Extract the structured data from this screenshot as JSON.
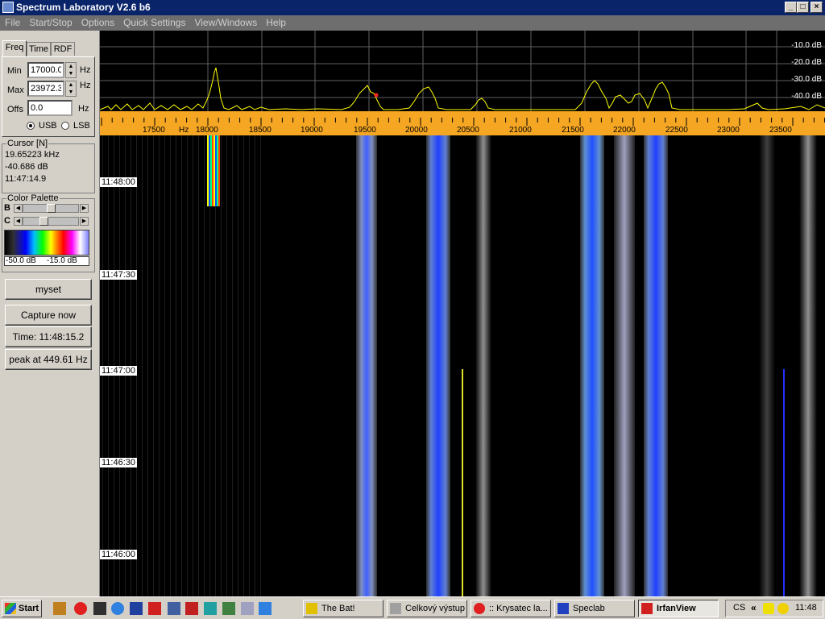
{
  "window": {
    "title": "Spectrum Laboratory V2.6 b6"
  },
  "menu": [
    "File",
    "Start/Stop",
    "Options",
    "Quick Settings",
    "View/Windows",
    "Help"
  ],
  "tabs": [
    "Freq",
    "Time",
    "RDF"
  ],
  "freq": {
    "min_label": "Min",
    "min_value": "17000.0",
    "unit1": "Hz",
    "max_label": "Max",
    "max_value": "23972.3",
    "unit2": "Hz",
    "offs_label": "Offs",
    "offs_value": "0.0",
    "unit3": "Hz",
    "usb": "USB",
    "lsb": "LSB"
  },
  "cursor": {
    "title": "Cursor [N]",
    "freq": "19.65223 kHz",
    "level": "-40.686 dB",
    "time": "11:47:14.9"
  },
  "palette": {
    "title": "Color Palette",
    "b_label": "B",
    "c_label": "C",
    "low": "-50.0 dB",
    "high": "-15.0 dB"
  },
  "buttons": {
    "myset": "myset",
    "capture": "Capture now",
    "time": "Time:  11:48:15.2",
    "peak": "peak at 449.61 Hz"
  },
  "spectrum": {
    "db_labels": [
      "-10.0 dB",
      "-20.0 dB",
      "-30.0 dB",
      "-40.0 dB"
    ],
    "freq_labels": [
      "17500",
      "Hz",
      "18000",
      "18500",
      "19000",
      "19500",
      "20000",
      "20500",
      "21000",
      "21500",
      "22000",
      "22500",
      "23000",
      "23500"
    ]
  },
  "waterfall": {
    "time_labels": [
      "11:48:00",
      "11:47:30",
      "11:47:00",
      "11:46:30",
      "11:46:00"
    ]
  },
  "taskbar": {
    "start": "Start",
    "tasks": [
      "The Bat!",
      "Celkový výstup",
      ":: Krysatec la...",
      "Speclab",
      "IrfanView"
    ],
    "tray_clock": "11:48",
    "tray_lang": "CS"
  }
}
